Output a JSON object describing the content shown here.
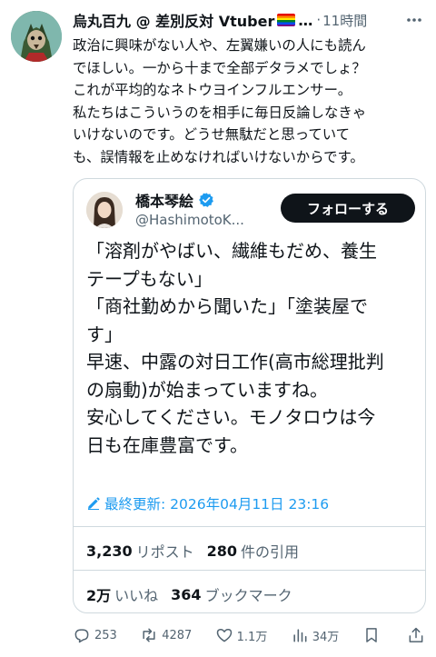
{
  "post": {
    "author_name": "烏丸百九 @ 差別反対 Vtuber",
    "ellipsis": "…",
    "dot": "·",
    "time": "11時間",
    "body_lines": [
      "政治に興味がない人や、左翼嫌いの人にも読ん",
      "でほしい。一から十まで全部デタラメでしょ？",
      "これが平均的なネトウヨインフルエンサー。",
      "私たちはこういうのを相手に毎日反論しなきゃ",
      "いけないのです。どうせ無駄だと思っていて",
      "も、誤情報を止めなければいけないからです。"
    ]
  },
  "quote": {
    "name": "橋本琴絵",
    "handle": "@HashimotoK...",
    "follow_label": "フォローする",
    "text_lines": [
      "「溶剤がやばい、繊維もだめ、養生",
      "テープもない」",
      "「商社勤めから聞いた」「塗装屋で",
      "す」",
      "早速、中露の対日工作(高市総理批判",
      "の扇動)が始まっていますね。",
      "安心してください。モノタロウは今",
      "日も在庫豊富です。"
    ],
    "edited": "最終更新: 2026年04月11日 23:16",
    "stats_row1": [
      {
        "num": "3,230",
        "label": "リポスト"
      },
      {
        "num": "280",
        "label": "件の引用"
      }
    ],
    "stats_row2": [
      {
        "num": "2万",
        "label": "いいね"
      },
      {
        "num": "364",
        "label": "ブックマーク"
      }
    ]
  },
  "actions": {
    "reply": "253",
    "repost": "4287",
    "like": "1.1万",
    "views": "34万"
  },
  "colors": {
    "accent": "#1d9bf0",
    "text": "#0f1419",
    "secondary": "#536471",
    "border": "#cfd9de"
  }
}
